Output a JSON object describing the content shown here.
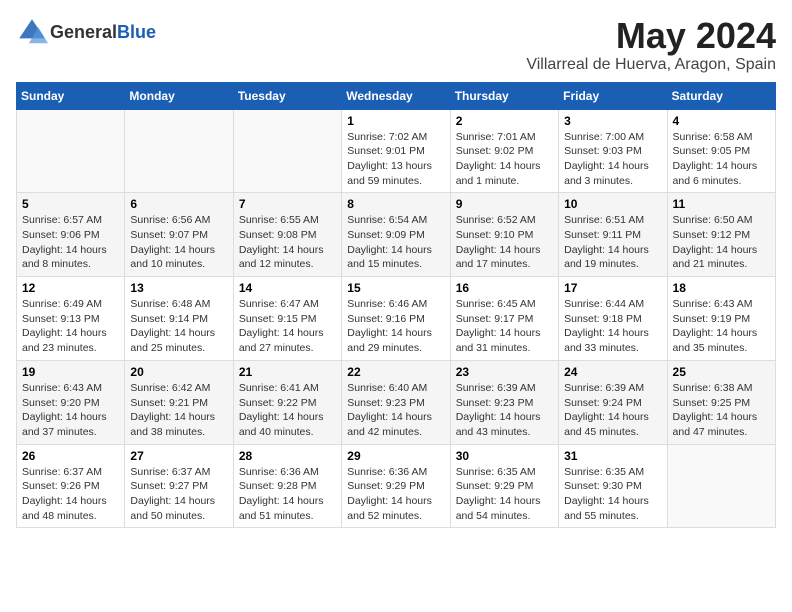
{
  "header": {
    "logo_general": "General",
    "logo_blue": "Blue",
    "title": "May 2024",
    "subtitle": "Villarreal de Huerva, Aragon, Spain"
  },
  "weekdays": [
    "Sunday",
    "Monday",
    "Tuesday",
    "Wednesday",
    "Thursday",
    "Friday",
    "Saturday"
  ],
  "weeks": [
    [
      {
        "day": "",
        "sunrise": "",
        "sunset": "",
        "daylight": ""
      },
      {
        "day": "",
        "sunrise": "",
        "sunset": "",
        "daylight": ""
      },
      {
        "day": "",
        "sunrise": "",
        "sunset": "",
        "daylight": ""
      },
      {
        "day": "1",
        "sunrise": "Sunrise: 7:02 AM",
        "sunset": "Sunset: 9:01 PM",
        "daylight": "Daylight: 13 hours and 59 minutes."
      },
      {
        "day": "2",
        "sunrise": "Sunrise: 7:01 AM",
        "sunset": "Sunset: 9:02 PM",
        "daylight": "Daylight: 14 hours and 1 minute."
      },
      {
        "day": "3",
        "sunrise": "Sunrise: 7:00 AM",
        "sunset": "Sunset: 9:03 PM",
        "daylight": "Daylight: 14 hours and 3 minutes."
      },
      {
        "day": "4",
        "sunrise": "Sunrise: 6:58 AM",
        "sunset": "Sunset: 9:05 PM",
        "daylight": "Daylight: 14 hours and 6 minutes."
      }
    ],
    [
      {
        "day": "5",
        "sunrise": "Sunrise: 6:57 AM",
        "sunset": "Sunset: 9:06 PM",
        "daylight": "Daylight: 14 hours and 8 minutes."
      },
      {
        "day": "6",
        "sunrise": "Sunrise: 6:56 AM",
        "sunset": "Sunset: 9:07 PM",
        "daylight": "Daylight: 14 hours and 10 minutes."
      },
      {
        "day": "7",
        "sunrise": "Sunrise: 6:55 AM",
        "sunset": "Sunset: 9:08 PM",
        "daylight": "Daylight: 14 hours and 12 minutes."
      },
      {
        "day": "8",
        "sunrise": "Sunrise: 6:54 AM",
        "sunset": "Sunset: 9:09 PM",
        "daylight": "Daylight: 14 hours and 15 minutes."
      },
      {
        "day": "9",
        "sunrise": "Sunrise: 6:52 AM",
        "sunset": "Sunset: 9:10 PM",
        "daylight": "Daylight: 14 hours and 17 minutes."
      },
      {
        "day": "10",
        "sunrise": "Sunrise: 6:51 AM",
        "sunset": "Sunset: 9:11 PM",
        "daylight": "Daylight: 14 hours and 19 minutes."
      },
      {
        "day": "11",
        "sunrise": "Sunrise: 6:50 AM",
        "sunset": "Sunset: 9:12 PM",
        "daylight": "Daylight: 14 hours and 21 minutes."
      }
    ],
    [
      {
        "day": "12",
        "sunrise": "Sunrise: 6:49 AM",
        "sunset": "Sunset: 9:13 PM",
        "daylight": "Daylight: 14 hours and 23 minutes."
      },
      {
        "day": "13",
        "sunrise": "Sunrise: 6:48 AM",
        "sunset": "Sunset: 9:14 PM",
        "daylight": "Daylight: 14 hours and 25 minutes."
      },
      {
        "day": "14",
        "sunrise": "Sunrise: 6:47 AM",
        "sunset": "Sunset: 9:15 PM",
        "daylight": "Daylight: 14 hours and 27 minutes."
      },
      {
        "day": "15",
        "sunrise": "Sunrise: 6:46 AM",
        "sunset": "Sunset: 9:16 PM",
        "daylight": "Daylight: 14 hours and 29 minutes."
      },
      {
        "day": "16",
        "sunrise": "Sunrise: 6:45 AM",
        "sunset": "Sunset: 9:17 PM",
        "daylight": "Daylight: 14 hours and 31 minutes."
      },
      {
        "day": "17",
        "sunrise": "Sunrise: 6:44 AM",
        "sunset": "Sunset: 9:18 PM",
        "daylight": "Daylight: 14 hours and 33 minutes."
      },
      {
        "day": "18",
        "sunrise": "Sunrise: 6:43 AM",
        "sunset": "Sunset: 9:19 PM",
        "daylight": "Daylight: 14 hours and 35 minutes."
      }
    ],
    [
      {
        "day": "19",
        "sunrise": "Sunrise: 6:43 AM",
        "sunset": "Sunset: 9:20 PM",
        "daylight": "Daylight: 14 hours and 37 minutes."
      },
      {
        "day": "20",
        "sunrise": "Sunrise: 6:42 AM",
        "sunset": "Sunset: 9:21 PM",
        "daylight": "Daylight: 14 hours and 38 minutes."
      },
      {
        "day": "21",
        "sunrise": "Sunrise: 6:41 AM",
        "sunset": "Sunset: 9:22 PM",
        "daylight": "Daylight: 14 hours and 40 minutes."
      },
      {
        "day": "22",
        "sunrise": "Sunrise: 6:40 AM",
        "sunset": "Sunset: 9:23 PM",
        "daylight": "Daylight: 14 hours and 42 minutes."
      },
      {
        "day": "23",
        "sunrise": "Sunrise: 6:39 AM",
        "sunset": "Sunset: 9:23 PM",
        "daylight": "Daylight: 14 hours and 43 minutes."
      },
      {
        "day": "24",
        "sunrise": "Sunrise: 6:39 AM",
        "sunset": "Sunset: 9:24 PM",
        "daylight": "Daylight: 14 hours and 45 minutes."
      },
      {
        "day": "25",
        "sunrise": "Sunrise: 6:38 AM",
        "sunset": "Sunset: 9:25 PM",
        "daylight": "Daylight: 14 hours and 47 minutes."
      }
    ],
    [
      {
        "day": "26",
        "sunrise": "Sunrise: 6:37 AM",
        "sunset": "Sunset: 9:26 PM",
        "daylight": "Daylight: 14 hours and 48 minutes."
      },
      {
        "day": "27",
        "sunrise": "Sunrise: 6:37 AM",
        "sunset": "Sunset: 9:27 PM",
        "daylight": "Daylight: 14 hours and 50 minutes."
      },
      {
        "day": "28",
        "sunrise": "Sunrise: 6:36 AM",
        "sunset": "Sunset: 9:28 PM",
        "daylight": "Daylight: 14 hours and 51 minutes."
      },
      {
        "day": "29",
        "sunrise": "Sunrise: 6:36 AM",
        "sunset": "Sunset: 9:29 PM",
        "daylight": "Daylight: 14 hours and 52 minutes."
      },
      {
        "day": "30",
        "sunrise": "Sunrise: 6:35 AM",
        "sunset": "Sunset: 9:29 PM",
        "daylight": "Daylight: 14 hours and 54 minutes."
      },
      {
        "day": "31",
        "sunrise": "Sunrise: 6:35 AM",
        "sunset": "Sunset: 9:30 PM",
        "daylight": "Daylight: 14 hours and 55 minutes."
      },
      {
        "day": "",
        "sunrise": "",
        "sunset": "",
        "daylight": ""
      }
    ]
  ]
}
